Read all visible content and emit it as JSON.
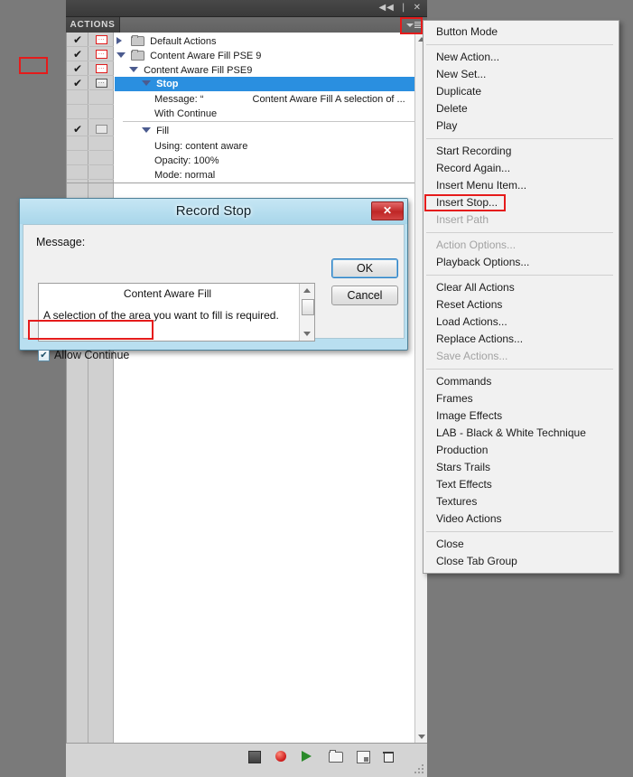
{
  "panel": {
    "topbar": {
      "collapse_icon": "◀◀",
      "divider": "|",
      "close_icon": "✕"
    },
    "tab_label": "ACTIONS",
    "menu_button_name": "panel-menu-button",
    "rows": [
      {
        "checked": "✔",
        "dialog": "red",
        "twisty": "right",
        "folder": true,
        "label": "Default Actions",
        "indent": 0,
        "selected": false
      },
      {
        "checked": "✔",
        "dialog": "red",
        "twisty": "down",
        "folder": true,
        "label": "Content Aware Fill PSE 9",
        "indent": 0,
        "selected": false
      },
      {
        "checked": "✔",
        "dialog": "red",
        "twisty": "down",
        "folder": false,
        "label": "Content Aware Fill PSE9",
        "indent": 1,
        "selected": false
      },
      {
        "checked": "✔",
        "dialog": "gray",
        "twisty": "down",
        "folder": false,
        "label": "Stop",
        "indent": 2,
        "selected": true
      },
      {
        "checked": "",
        "dialog": "none",
        "twisty": "none",
        "folder": false,
        "label": "Message:  “",
        "indent": 3,
        "selected": false,
        "label2": "Content Aware Fill  A selection of ..."
      },
      {
        "checked": "",
        "dialog": "none",
        "twisty": "none",
        "folder": false,
        "label": "With Continue",
        "indent": 3,
        "selected": false
      },
      {
        "checked": "✔",
        "dialog": "empty",
        "twisty": "down",
        "folder": false,
        "label": "Fill",
        "indent": 2,
        "selected": false
      },
      {
        "checked": "",
        "dialog": "none",
        "twisty": "none",
        "folder": false,
        "label": "Using: content aware",
        "indent": 3,
        "selected": false
      },
      {
        "checked": "",
        "dialog": "none",
        "twisty": "none",
        "folder": false,
        "label": "Opacity: 100%",
        "indent": 3,
        "selected": false
      },
      {
        "checked": "",
        "dialog": "none",
        "twisty": "none",
        "folder": false,
        "label": "Mode: normal",
        "indent": 3,
        "selected": false
      }
    ],
    "footer_tools": [
      {
        "name": "stop-button",
        "icon": "stop-icon"
      },
      {
        "name": "begin-recording-button",
        "icon": "record-icon"
      },
      {
        "name": "play-selection-button",
        "icon": "play-icon"
      },
      {
        "name": "create-new-set-button",
        "icon": "folder-icon"
      },
      {
        "name": "create-new-action-button",
        "icon": "new-document-icon"
      },
      {
        "name": "delete-button",
        "icon": "trash-icon"
      }
    ]
  },
  "context_menu": {
    "groups": [
      [
        {
          "label": "Button Mode",
          "disabled": false
        }
      ],
      [
        {
          "label": "New Action...",
          "disabled": false
        },
        {
          "label": "New Set...",
          "disabled": false
        },
        {
          "label": "Duplicate",
          "disabled": false
        },
        {
          "label": "Delete",
          "disabled": false
        },
        {
          "label": "Play",
          "disabled": false
        }
      ],
      [
        {
          "label": "Start Recording",
          "disabled": false
        },
        {
          "label": "Record Again...",
          "disabled": false
        },
        {
          "label": "Insert Menu Item...",
          "disabled": false
        },
        {
          "label": "Insert Stop...",
          "disabled": false,
          "highlighted": true
        },
        {
          "label": "Insert Path",
          "disabled": true
        }
      ],
      [
        {
          "label": "Action Options...",
          "disabled": true
        },
        {
          "label": "Playback Options...",
          "disabled": false
        }
      ],
      [
        {
          "label": "Clear All Actions",
          "disabled": false
        },
        {
          "label": "Reset Actions",
          "disabled": false
        },
        {
          "label": "Load Actions...",
          "disabled": false
        },
        {
          "label": "Replace Actions...",
          "disabled": false
        },
        {
          "label": "Save Actions...",
          "disabled": true
        }
      ],
      [
        {
          "label": "Commands",
          "disabled": false
        },
        {
          "label": "Frames",
          "disabled": false
        },
        {
          "label": "Image Effects",
          "disabled": false
        },
        {
          "label": "LAB - Black & White Technique",
          "disabled": false
        },
        {
          "label": "Production",
          "disabled": false
        },
        {
          "label": "Stars Trails",
          "disabled": false
        },
        {
          "label": "Text Effects",
          "disabled": false
        },
        {
          "label": "Textures",
          "disabled": false
        },
        {
          "label": "Video Actions",
          "disabled": false
        }
      ],
      [
        {
          "label": "Close",
          "disabled": false
        },
        {
          "label": "Close Tab Group",
          "disabled": false
        }
      ]
    ]
  },
  "dialog": {
    "title": "Record Stop",
    "close_label": "✕",
    "message_label": "Message:",
    "message_line1": "Content Aware Fill",
    "message_line2": "A selection of the area you want to fill is required.",
    "allow_continue_label": "Allow Continue",
    "allow_continue_checked": "✔",
    "ok_label": "OK",
    "cancel_label": "Cancel"
  },
  "colors": {
    "highlight_red": "#e51b1b",
    "selection_blue": "#2a8fe0",
    "dialog_title_blue": "#b9dff0",
    "desktop_gray": "#7a7a7a"
  }
}
